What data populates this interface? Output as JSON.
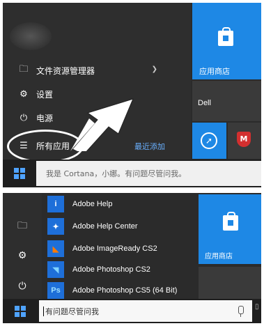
{
  "panel1": {
    "menu": [
      {
        "label": "文件资源管理器",
        "icon": "file-explorer-icon",
        "has_chevron": true
      },
      {
        "label": "设置",
        "icon": "gear-icon"
      },
      {
        "label": "电源",
        "icon": "power-icon"
      },
      {
        "label": "所有应用",
        "icon": "all-apps-icon"
      }
    ],
    "recently_added": "最近添加",
    "tiles": [
      {
        "label": "应用商店",
        "color": "#1e88e5"
      },
      {
        "label": "Dell",
        "color": "#3a3a3a"
      },
      {
        "label": "",
        "icon": "safari-compass-icon",
        "color": "#1e88e5"
      },
      {
        "label": "",
        "icon": "mcafee-shield-icon",
        "color": "#3a3a3a"
      }
    ],
    "search_text": "我是 Cortana，小娜。有问题尽管问我。"
  },
  "panel2": {
    "apps": [
      {
        "label": "Adobe Help",
        "icon_color": "#1e6fd9",
        "glyph": "i"
      },
      {
        "label": "Adobe Help Center",
        "icon_color": "#1e6fd9",
        "glyph": "✦"
      },
      {
        "label": "Adobe ImageReady CS2",
        "icon_color": "#1e6fd9",
        "glyph": "◣"
      },
      {
        "label": "Adobe Photoshop CS2",
        "icon_color": "#1e6fd9",
        "glyph": "◥"
      },
      {
        "label": "Adobe Photoshop CS5 (64 Bit)",
        "icon_color": "#1e6fd9",
        "glyph": "Ps"
      }
    ],
    "tiles": [
      {
        "label": "应用商店",
        "color": "#1e88e5"
      }
    ],
    "search_text": "有问题尽管问我"
  },
  "colors": {
    "accent": "#1e88e5",
    "link": "#69b0ff",
    "start_bg": "#2b2b2b"
  }
}
